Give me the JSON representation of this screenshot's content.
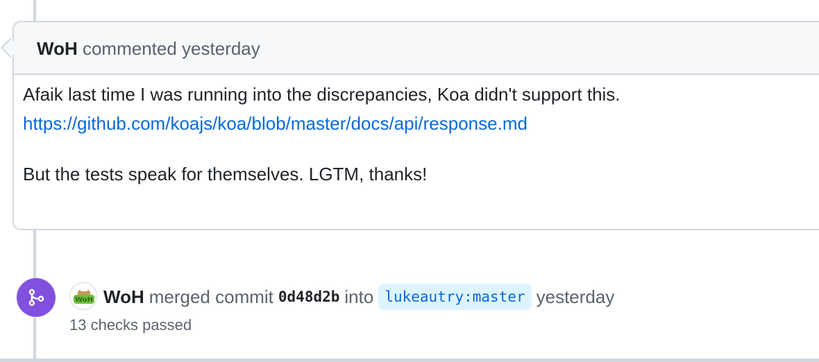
{
  "comment": {
    "author": "WoH",
    "action": "commented",
    "time": "yesterday",
    "body_line1": "Afaik last time I was running into the discrepancies, Koa didn't support this.",
    "link": "https://github.com/koajs/koa/blob/master/docs/api/response.md",
    "body_line2": "But the tests speak for themselves. LGTM, thanks!"
  },
  "merge_event": {
    "icon": "git-merge-icon",
    "avatar_text": "WoH",
    "author": "WoH",
    "action": "merged commit",
    "commit_sha": "0d48d2b",
    "into": "into",
    "branch": "lukeautry:master",
    "time": "yesterday",
    "checks": "13 checks passed"
  },
  "colors": {
    "merge_badge": "#8250df",
    "link": "#0969da",
    "branch_bg": "#ddf4ff"
  }
}
